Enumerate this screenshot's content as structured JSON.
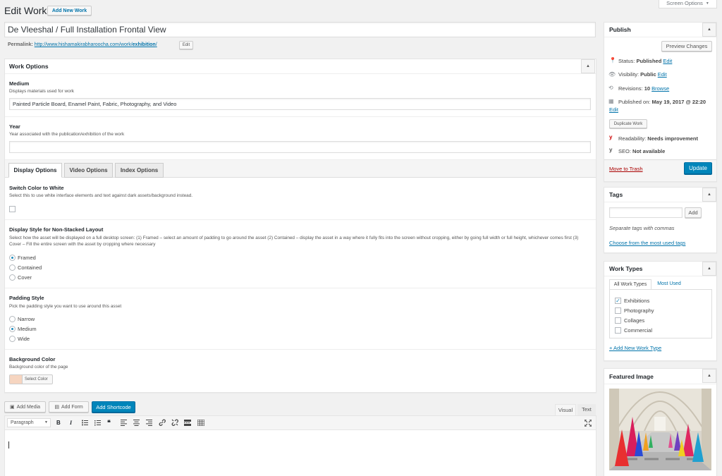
{
  "header": {
    "title": "Edit Work",
    "add_new_label": "Add New Work",
    "screen_options_label": "Screen Options",
    "screen_options_arrow": "▼"
  },
  "post": {
    "title_value": "De Vleeshal / Full Installation Frontal View",
    "permalink_label": "Permalink:",
    "permalink_base": "http://www.hishamakirabharoocha.com/work/",
    "permalink_slug": "exhibition",
    "permalink_slash": "/",
    "permalink_edit": "Edit"
  },
  "work_options": {
    "title": "Work Options",
    "medium_label": "Medium",
    "medium_desc": "Displays materials used for work",
    "medium_value": "Painted Particle Board, Enamel Paint, Fabric, Photography, and Video",
    "year_label": "Year",
    "year_desc": "Year associated with the publication/exhibition of the work",
    "year_value": "",
    "tabs": [
      {
        "label": "Display Options",
        "active": true
      },
      {
        "label": "Video Options",
        "active": false
      },
      {
        "label": "Index Options",
        "active": false
      }
    ],
    "switch_label": "Switch Color to White",
    "switch_desc": "Select this to use white interface elements and text against dark assets/background instead.",
    "layout_label": "Display Style for Non-Stacked Layout",
    "layout_desc": "Select how the asset will be displayed on a full desktop screen: (1) Framed – select an amount of padding to go around the asset (2) Contained – display the asset in a way where it fully fits into the screen without cropping, either by going full width or full height, whichever comes first (3) Cover – Fill the entire screen with the asset by cropping where necessary",
    "layout_options": [
      "Framed",
      "Contained",
      "Cover"
    ],
    "layout_selected": "Framed",
    "padding_label": "Padding Style",
    "padding_desc": "Pick the padding style you want to use around this asset",
    "padding_options": [
      "Narrow",
      "Medium",
      "Wide"
    ],
    "padding_selected": "Medium",
    "bg_label": "Background Color",
    "bg_desc": "Background color of the page",
    "bg_select_label": "Select Color",
    "bg_swatch_color": "#f6d5c0"
  },
  "editor": {
    "add_media": "Add Media",
    "add_form": "Add Form",
    "add_shortcode": "Add Shortcode",
    "tab_visual": "Visual",
    "tab_text": "Text",
    "format_select": "Paragraph",
    "toolbar_icons": [
      "bold-icon",
      "italic-icon",
      "bullet-list-icon",
      "numbered-list-icon",
      "blockquote-icon",
      "align-left-icon",
      "align-center-icon",
      "align-right-icon",
      "link-icon",
      "unlink-icon",
      "read-more-icon",
      "toolbar-toggle-icon"
    ],
    "bold_glyph": "B",
    "italic_glyph": "I",
    "quote_glyph": "❝"
  },
  "publish": {
    "title": "Publish",
    "preview_label": "Preview Changes",
    "status_label": "Status:",
    "status_value": "Published",
    "visibility_label": "Visibility:",
    "visibility_value": "Public",
    "revisions_label": "Revisions:",
    "revisions_value": "10",
    "browse_label": "Browse",
    "published_label": "Published on:",
    "published_value": "May 19, 2017 @ 22:20",
    "edit_label": "Edit",
    "duplicate_label": "Duplicate Work",
    "readability_label": "Readability:",
    "readability_value": "Needs improvement",
    "seo_label": "SEO:",
    "seo_value": "Not available",
    "trash_label": "Move to Trash",
    "update_label": "Update"
  },
  "tags": {
    "title": "Tags",
    "add_label": "Add",
    "hint": "Separate tags with commas",
    "choose_label": "Choose from the most used tags"
  },
  "work_types": {
    "title": "Work Types",
    "tab_all": "All Work Types",
    "tab_most": "Most Used",
    "items": [
      {
        "label": "Exhibitions",
        "checked": true
      },
      {
        "label": "Photography",
        "checked": false
      },
      {
        "label": "Collages",
        "checked": false
      },
      {
        "label": "Commercial",
        "checked": false
      }
    ],
    "add_new_label": "+ Add New Work Type"
  },
  "featured": {
    "title": "Featured Image"
  },
  "colors": {
    "accent": "#0073aa",
    "primary_button": "#0085ba",
    "trash": "#a00"
  }
}
